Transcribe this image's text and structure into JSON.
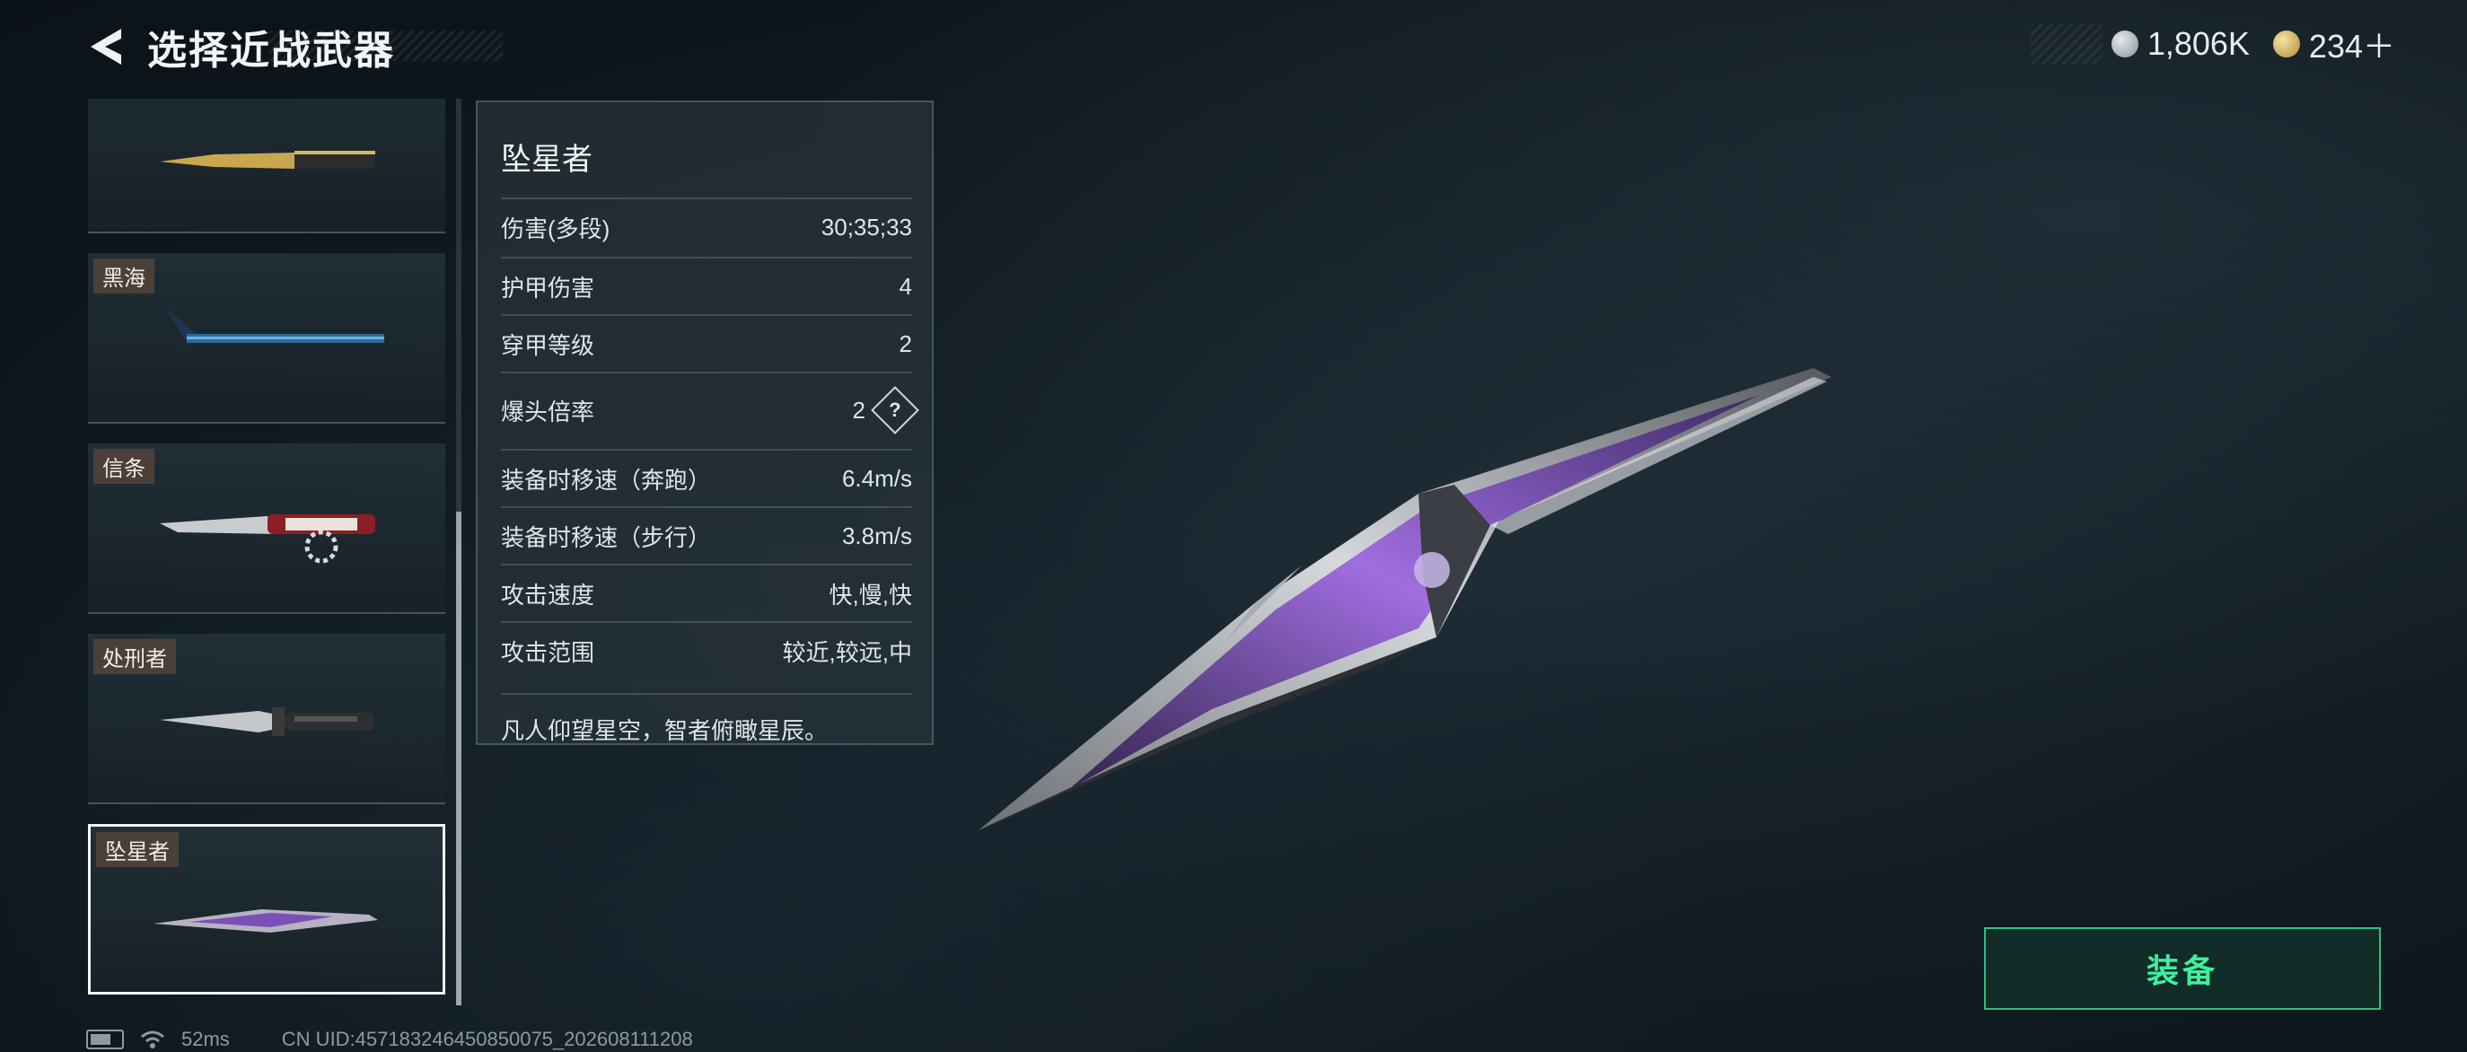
{
  "header": {
    "title": "选择近战武器"
  },
  "currency": [
    {
      "icon": "silver-coin-icon",
      "amount": "1,806K"
    },
    {
      "icon": "gold-coin-icon",
      "amount": "234＋"
    }
  ],
  "weapon_list": [
    {
      "name": "",
      "icon": "gold-knife-icon"
    },
    {
      "name": "黑海",
      "icon": "axe-icon"
    },
    {
      "name": "信条",
      "icon": "serrated-knife-icon"
    },
    {
      "name": "处刑者",
      "icon": "combat-knife-icon"
    },
    {
      "name": "坠星者",
      "icon": "star-blade-icon",
      "selected": true
    }
  ],
  "stats_panel": {
    "weapon_name": "坠星者",
    "rows": [
      {
        "label": "伤害(多段)",
        "value": "30;35;33"
      },
      {
        "label": "护甲伤害",
        "value": "4"
      },
      {
        "label": "穿甲等级",
        "value": "2"
      },
      {
        "label": "爆头倍率",
        "value": "2",
        "help": "?"
      },
      {
        "label": "装备时移速（奔跑）",
        "value": "6.4m/s"
      },
      {
        "label": "装备时移速（步行）",
        "value": "3.8m/s"
      },
      {
        "label": "攻击速度",
        "value": "快,慢,快"
      },
      {
        "label": "攻击范围",
        "value": "较近,较远,中"
      }
    ],
    "description": "凡人仰望星空，智者俯瞰星辰。"
  },
  "equip_button": {
    "label": "装备"
  },
  "footer": {
    "ping": "52ms",
    "uid": "CN UID:457183246450850075_202608111208"
  },
  "colors": {
    "accent_green": "#3ff0a0",
    "tag_brown": "#4a4037",
    "blade_purple": "#8a4fd1"
  }
}
